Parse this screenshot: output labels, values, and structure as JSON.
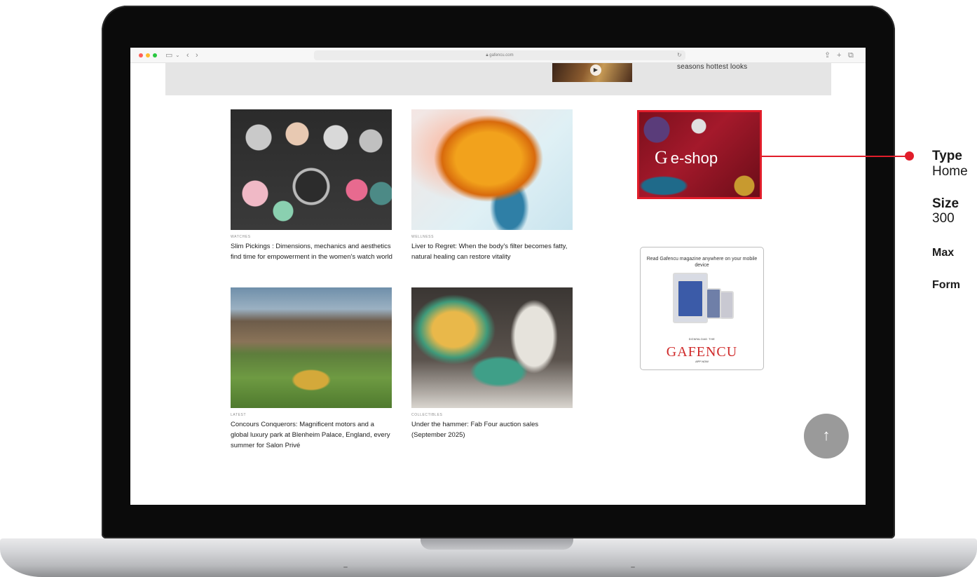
{
  "browser": {
    "url": "gafencu.com"
  },
  "top_banner": {
    "text": "seasons hottest looks"
  },
  "articles": [
    {
      "category": "WATCHES",
      "headline": "Slim Pickings : Dimensions, mechanics and aesthetics find time for empowerment in the women's watch world"
    },
    {
      "category": "WELLNESS",
      "headline": "Liver to Regret: When the body's filter becomes fatty, natural healing can restore vitality"
    },
    {
      "category": "LATEST",
      "headline": "Concours Conquerors: Magnificent motors and a global luxury park at Blenheim Palace, England, every summer for Salon Privé"
    },
    {
      "category": "COLLECTIBLES",
      "headline": "Under the hammer: Fab Four auction sales (September 2025)"
    }
  ],
  "sidebar": {
    "eshop_ad": {
      "label": "e-shop",
      "logo_letter": "G"
    },
    "magazine_ad": {
      "title": "Read Gafencu magazine anywhere on your mobile device",
      "download": "DOWNLOAD THE",
      "brand": "GAFENCU",
      "app_now": "APP NOW"
    }
  },
  "scroll_top_glyph": "↑",
  "annotation": {
    "type_label": "Type",
    "type_value": "Home",
    "size_label": "Size",
    "size_value": "300",
    "max_label": "Max",
    "format_label": "Form"
  },
  "colors": {
    "accent": "#e11d2a",
    "screen_bg": "#ffffff",
    "banner_bg": "#e5e5e5"
  }
}
